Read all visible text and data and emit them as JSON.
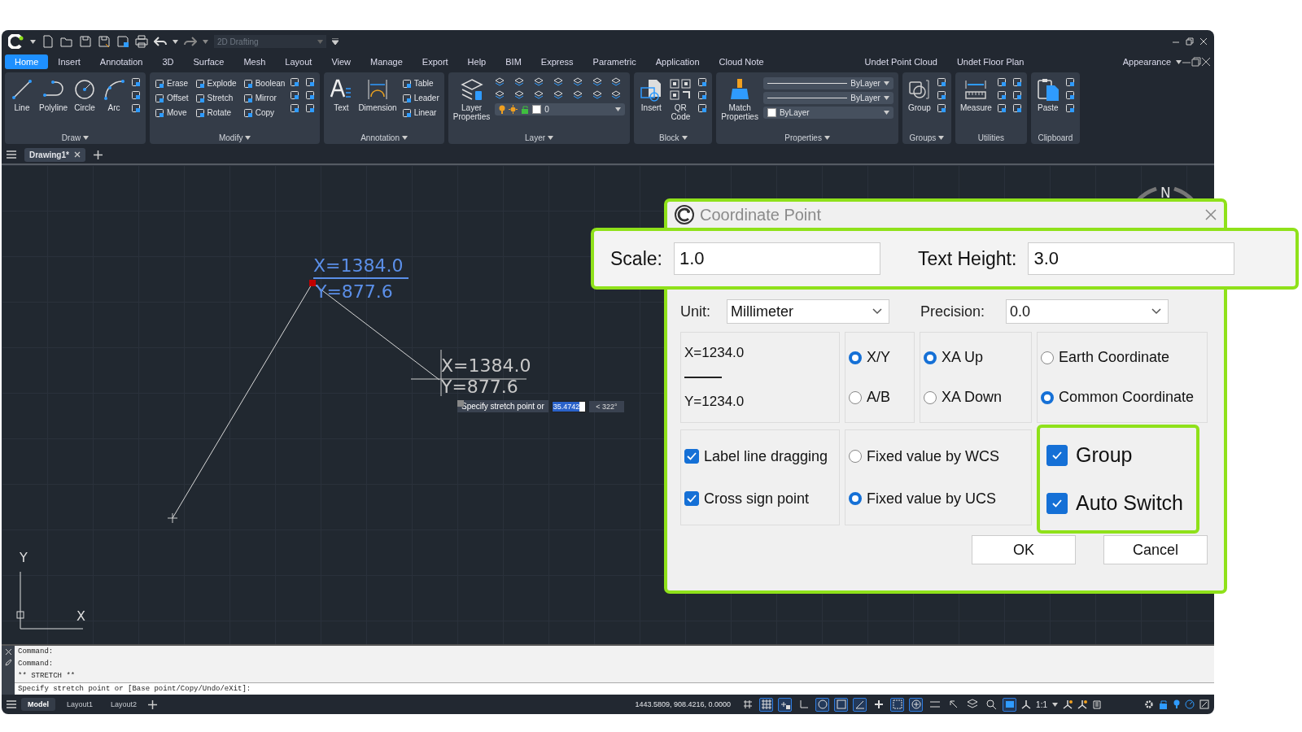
{
  "quick_access": {
    "workspace": "2D Drafting"
  },
  "menu_tabs": [
    {
      "label": "Home",
      "selected": true
    },
    {
      "label": "Insert",
      "selected": false
    },
    {
      "label": "Annotation",
      "selected": false
    },
    {
      "label": "3D",
      "selected": false
    },
    {
      "label": "Surface",
      "selected": false
    },
    {
      "label": "Mesh",
      "selected": false
    },
    {
      "label": "Layout",
      "selected": false
    },
    {
      "label": "View",
      "selected": false
    },
    {
      "label": "Manage",
      "selected": false
    },
    {
      "label": "Export",
      "selected": false
    },
    {
      "label": "Help",
      "selected": false
    },
    {
      "label": "BIM",
      "selected": false
    },
    {
      "label": "Express",
      "selected": false
    },
    {
      "label": "Parametric",
      "selected": false
    },
    {
      "label": "Application",
      "selected": false
    },
    {
      "label": "Cloud Note",
      "selected": false
    },
    {
      "label": "Undet Point Cloud",
      "selected": false
    },
    {
      "label": "Undet Floor Plan",
      "selected": false
    }
  ],
  "appearance": "Appearance",
  "ribbon_panels": [
    {
      "title": "Draw",
      "has_menu": true,
      "tools": [
        {
          "label": "Line",
          "kind": "large"
        },
        {
          "label": "Polyline",
          "kind": "large"
        },
        {
          "label": "Circle",
          "kind": "large"
        },
        {
          "label": "Arc",
          "kind": "large"
        }
      ]
    },
    {
      "title": "Modify",
      "has_menu": true,
      "tools": [
        {
          "label": "Erase",
          "kind": "small"
        },
        {
          "label": "Explode",
          "kind": "small"
        },
        {
          "label": "Boolean",
          "kind": "small"
        },
        {
          "label": "Offset",
          "kind": "small"
        },
        {
          "label": "Stretch",
          "kind": "small"
        },
        {
          "label": "Mirror",
          "kind": "small"
        },
        {
          "label": "Move",
          "kind": "small"
        },
        {
          "label": "Rotate",
          "kind": "small"
        },
        {
          "label": "Copy",
          "kind": "small"
        }
      ]
    },
    {
      "title": "Annotation",
      "has_menu": true,
      "tools": [
        {
          "label": "Text",
          "kind": "large"
        },
        {
          "label": "Dimension",
          "kind": "large"
        },
        {
          "label": "Table",
          "kind": "small"
        },
        {
          "label": "Leader",
          "kind": "small"
        },
        {
          "label": "Linear",
          "kind": "small"
        }
      ]
    },
    {
      "title": "Layer",
      "has_menu": true,
      "tools": [
        {
          "label": "Layer Properties",
          "kind": "large"
        }
      ],
      "dropdowns": [
        {
          "value": "0",
          "kind": "layer"
        }
      ]
    },
    {
      "title": "Block",
      "has_menu": true,
      "tools": [
        {
          "label": "Insert",
          "kind": "large"
        },
        {
          "label": "QR Code",
          "kind": "large"
        }
      ]
    },
    {
      "title": "Properties",
      "has_menu": true,
      "tools": [
        {
          "label": "Match Properties",
          "kind": "large"
        }
      ],
      "dropdowns": [
        {
          "value": "ByLayer",
          "kind": "line"
        },
        {
          "value": "ByLayer",
          "kind": "line"
        },
        {
          "value": "ByLayer",
          "kind": "color"
        }
      ]
    },
    {
      "title": "Groups",
      "has_menu": true,
      "tools": [
        {
          "label": "Group",
          "kind": "large"
        }
      ]
    },
    {
      "title": "Utilities",
      "has_menu": false,
      "tools": [
        {
          "label": "Measure",
          "kind": "large"
        }
      ]
    },
    {
      "title": "Clipboard",
      "has_menu": false,
      "tools": [
        {
          "label": "Paste",
          "kind": "large"
        }
      ]
    }
  ],
  "document_tabs": [
    {
      "label": "Drawing1*",
      "selected": true
    }
  ],
  "canvas": {
    "point_label": {
      "x": "X=1384.0",
      "y": "Y=877.6"
    },
    "preview_label": {
      "x": "X=1384.0",
      "y": "Y=877.6"
    },
    "tooltip": {
      "prompt": "Specify stretch point or",
      "distance": "35.4742",
      "angle": "< 322°"
    },
    "compass": "N",
    "ucs": {
      "y": "Y",
      "x": "X"
    }
  },
  "command_line": {
    "history": [
      "Command:",
      "Command:",
      "** STRETCH **"
    ],
    "prompt": "Specify stretch point or [Base point/Copy/Undo/eXit]:"
  },
  "layout_tabs": [
    {
      "label": "Model",
      "kind": "model",
      "selected": true
    },
    {
      "label": "Layout1",
      "kind": "layout",
      "selected": false
    },
    {
      "label": "Layout2",
      "kind": "layout",
      "selected": false
    }
  ],
  "status_bar": {
    "coordinates": "1443.5809, 908.4216, 0.0000",
    "toggles": [
      {
        "on": false
      },
      {
        "on": true
      },
      {
        "on": true
      },
      {
        "on": false
      },
      {
        "on": true
      },
      {
        "on": true
      },
      {
        "on": true
      },
      {
        "on": false
      },
      {
        "on": true
      },
      {
        "on": true
      },
      {
        "on": false
      },
      {
        "on": false
      },
      {
        "on": false
      },
      {
        "on": false
      },
      {
        "on": true
      }
    ],
    "scale": "1:1"
  },
  "dialog": {
    "title": "Coordinate Point",
    "scale": {
      "label": "Scale:",
      "value": "1.0"
    },
    "text_height": {
      "label": "Text Height:",
      "value": "3.0"
    },
    "unit": {
      "label": "Unit:",
      "value": "Millimeter"
    },
    "precision": {
      "label": "Precision:",
      "value": "0.0"
    },
    "preview": {
      "x": "X=1234.0",
      "y": "Y=1234.0"
    },
    "axis_options": [
      {
        "label": "X/Y",
        "selected": true
      },
      {
        "label": "A/B",
        "selected": false
      }
    ],
    "direction_options": [
      {
        "label": "XA Up",
        "selected": true
      },
      {
        "label": "XA Down",
        "selected": false
      }
    ],
    "coordinate_options": [
      {
        "label": "Earth Coordinate",
        "selected": false
      },
      {
        "label": "Common Coordinate",
        "selected": true
      }
    ],
    "label_options": [
      {
        "label": "Label line dragging",
        "checked": true
      },
      {
        "label": "Cross sign point",
        "checked": true
      }
    ],
    "value_options": [
      {
        "label": "Fixed value by WCS",
        "selected": false
      },
      {
        "label": "Fixed value by UCS",
        "selected": true
      }
    ],
    "group_options": [
      {
        "label": "Group",
        "checked": true
      },
      {
        "label": "Auto Switch",
        "checked": true
      }
    ],
    "buttons": [
      "OK",
      "Cancel"
    ]
  }
}
